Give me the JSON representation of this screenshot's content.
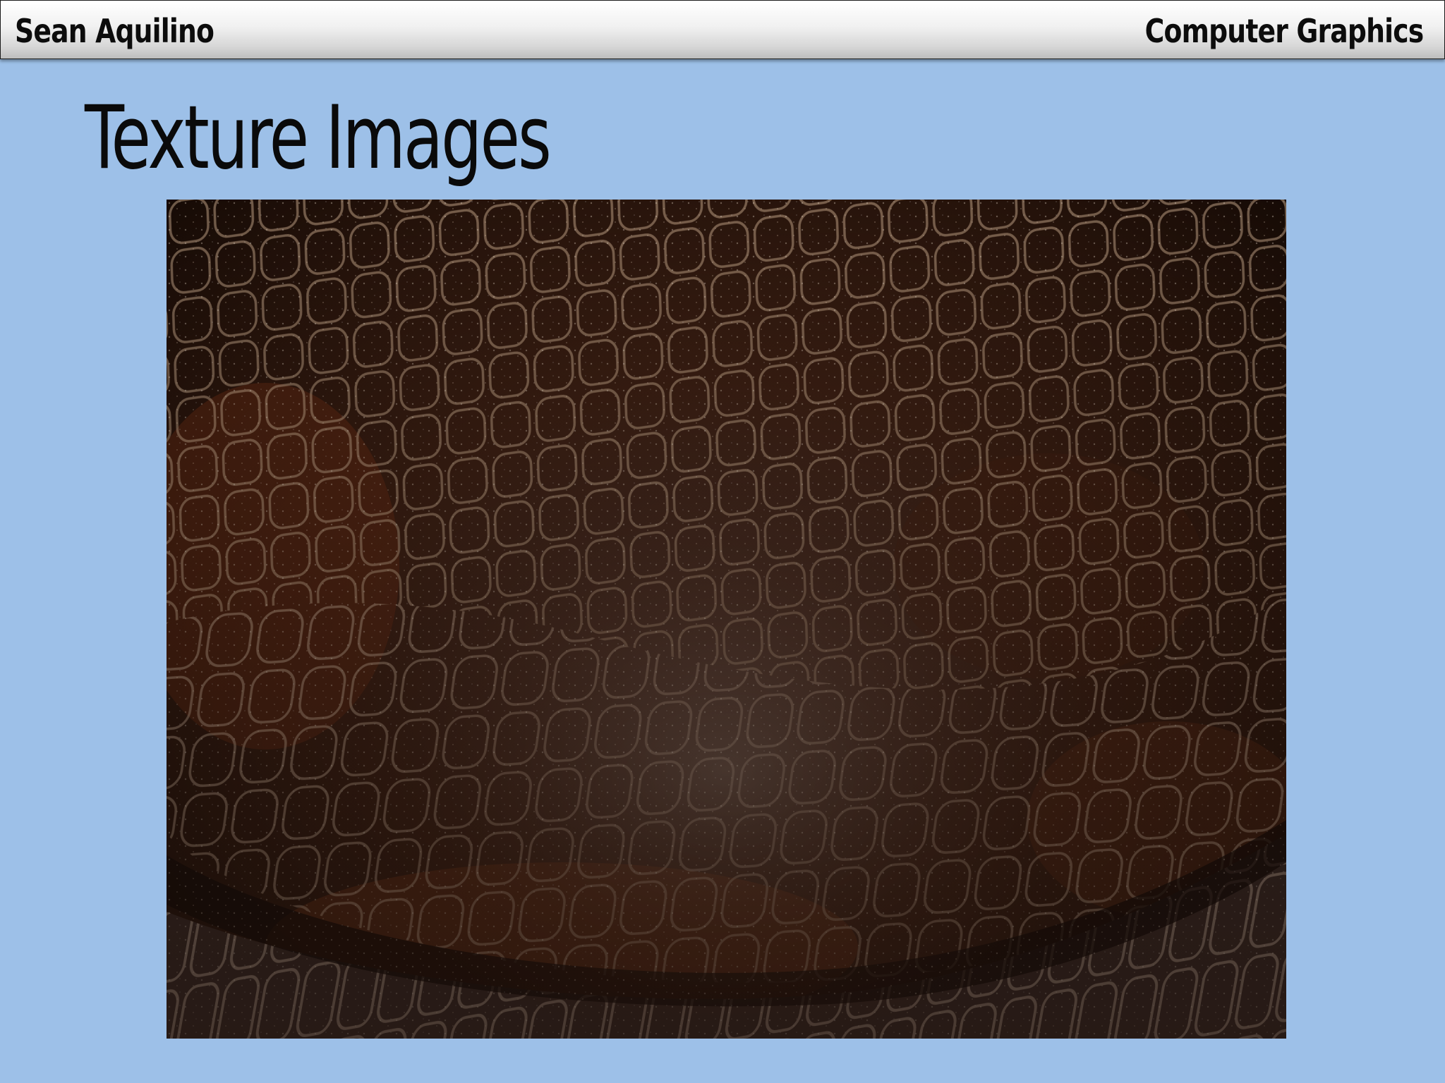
{
  "header": {
    "author": "Sean Aquilino",
    "course": "Computer Graphics"
  },
  "slide": {
    "title": "Texture Images",
    "background_color": "#9dc0e8"
  },
  "image": {
    "subject": "snakeskin-texture-photo",
    "dominant_colors": [
      "#2a150c",
      "#5a2a14",
      "#8a6048",
      "#d8c8b0"
    ]
  }
}
